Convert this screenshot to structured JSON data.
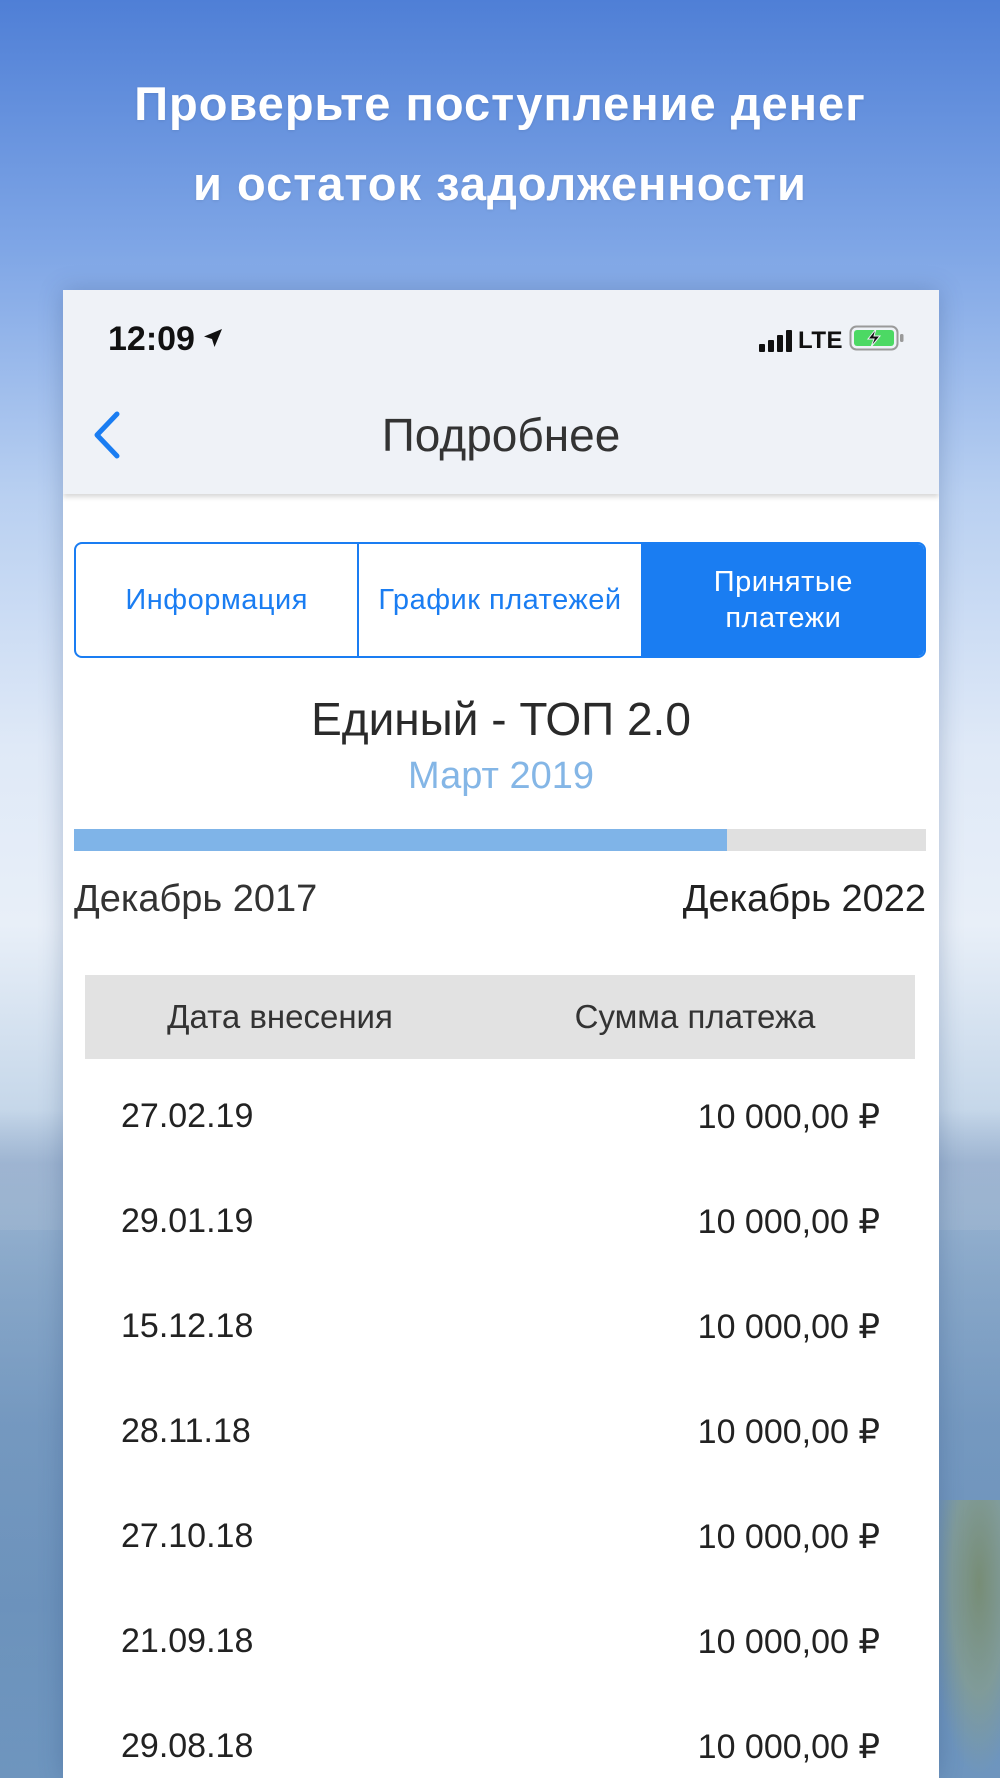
{
  "headline": {
    "line1": "Проверьте поступление денег",
    "line2": "и остаток задолженности"
  },
  "status_bar": {
    "time": "12:09",
    "network": "LTE",
    "location_icon": "location-arrow-icon",
    "signal_icon": "signal-bars-icon",
    "battery_icon": "battery-charging-icon"
  },
  "nav": {
    "title": "Подробнее",
    "back_icon": "chevron-left-icon"
  },
  "tabs": [
    {
      "label": "Информация",
      "active": false
    },
    {
      "label": "График платежей",
      "active": false
    },
    {
      "label": "Принятые платежи",
      "active": true
    }
  ],
  "product": {
    "name": "Единый - ТОП 2.0",
    "current_month": "Март 2019"
  },
  "term": {
    "start": "Декабрь 2017",
    "end": "Декабрь 2022",
    "progress_fraction": 0.766
  },
  "payments_table": {
    "columns": [
      "Дата внесения",
      "Сумма платежа"
    ],
    "rows": [
      {
        "date": "27.02.19",
        "amount": "10 000,00 ₽"
      },
      {
        "date": "29.01.19",
        "amount": "10 000,00 ₽"
      },
      {
        "date": "15.12.18",
        "amount": "10 000,00 ₽"
      },
      {
        "date": "28.11.18",
        "amount": "10 000,00 ₽"
      },
      {
        "date": "27.10.18",
        "amount": "10 000,00 ₽"
      },
      {
        "date": "21.09.18",
        "amount": "10 000,00 ₽"
      },
      {
        "date": "29.08.18",
        "amount": "10 000,00 ₽"
      }
    ]
  },
  "colors": {
    "accent": "#1a7df2",
    "progress_fill": "#7fb4e8",
    "progress_track": "#e0e0e0",
    "month_text": "#84b6e6",
    "header_bg": "#e2e2e2",
    "topbar_bg": "#eff2f7"
  }
}
